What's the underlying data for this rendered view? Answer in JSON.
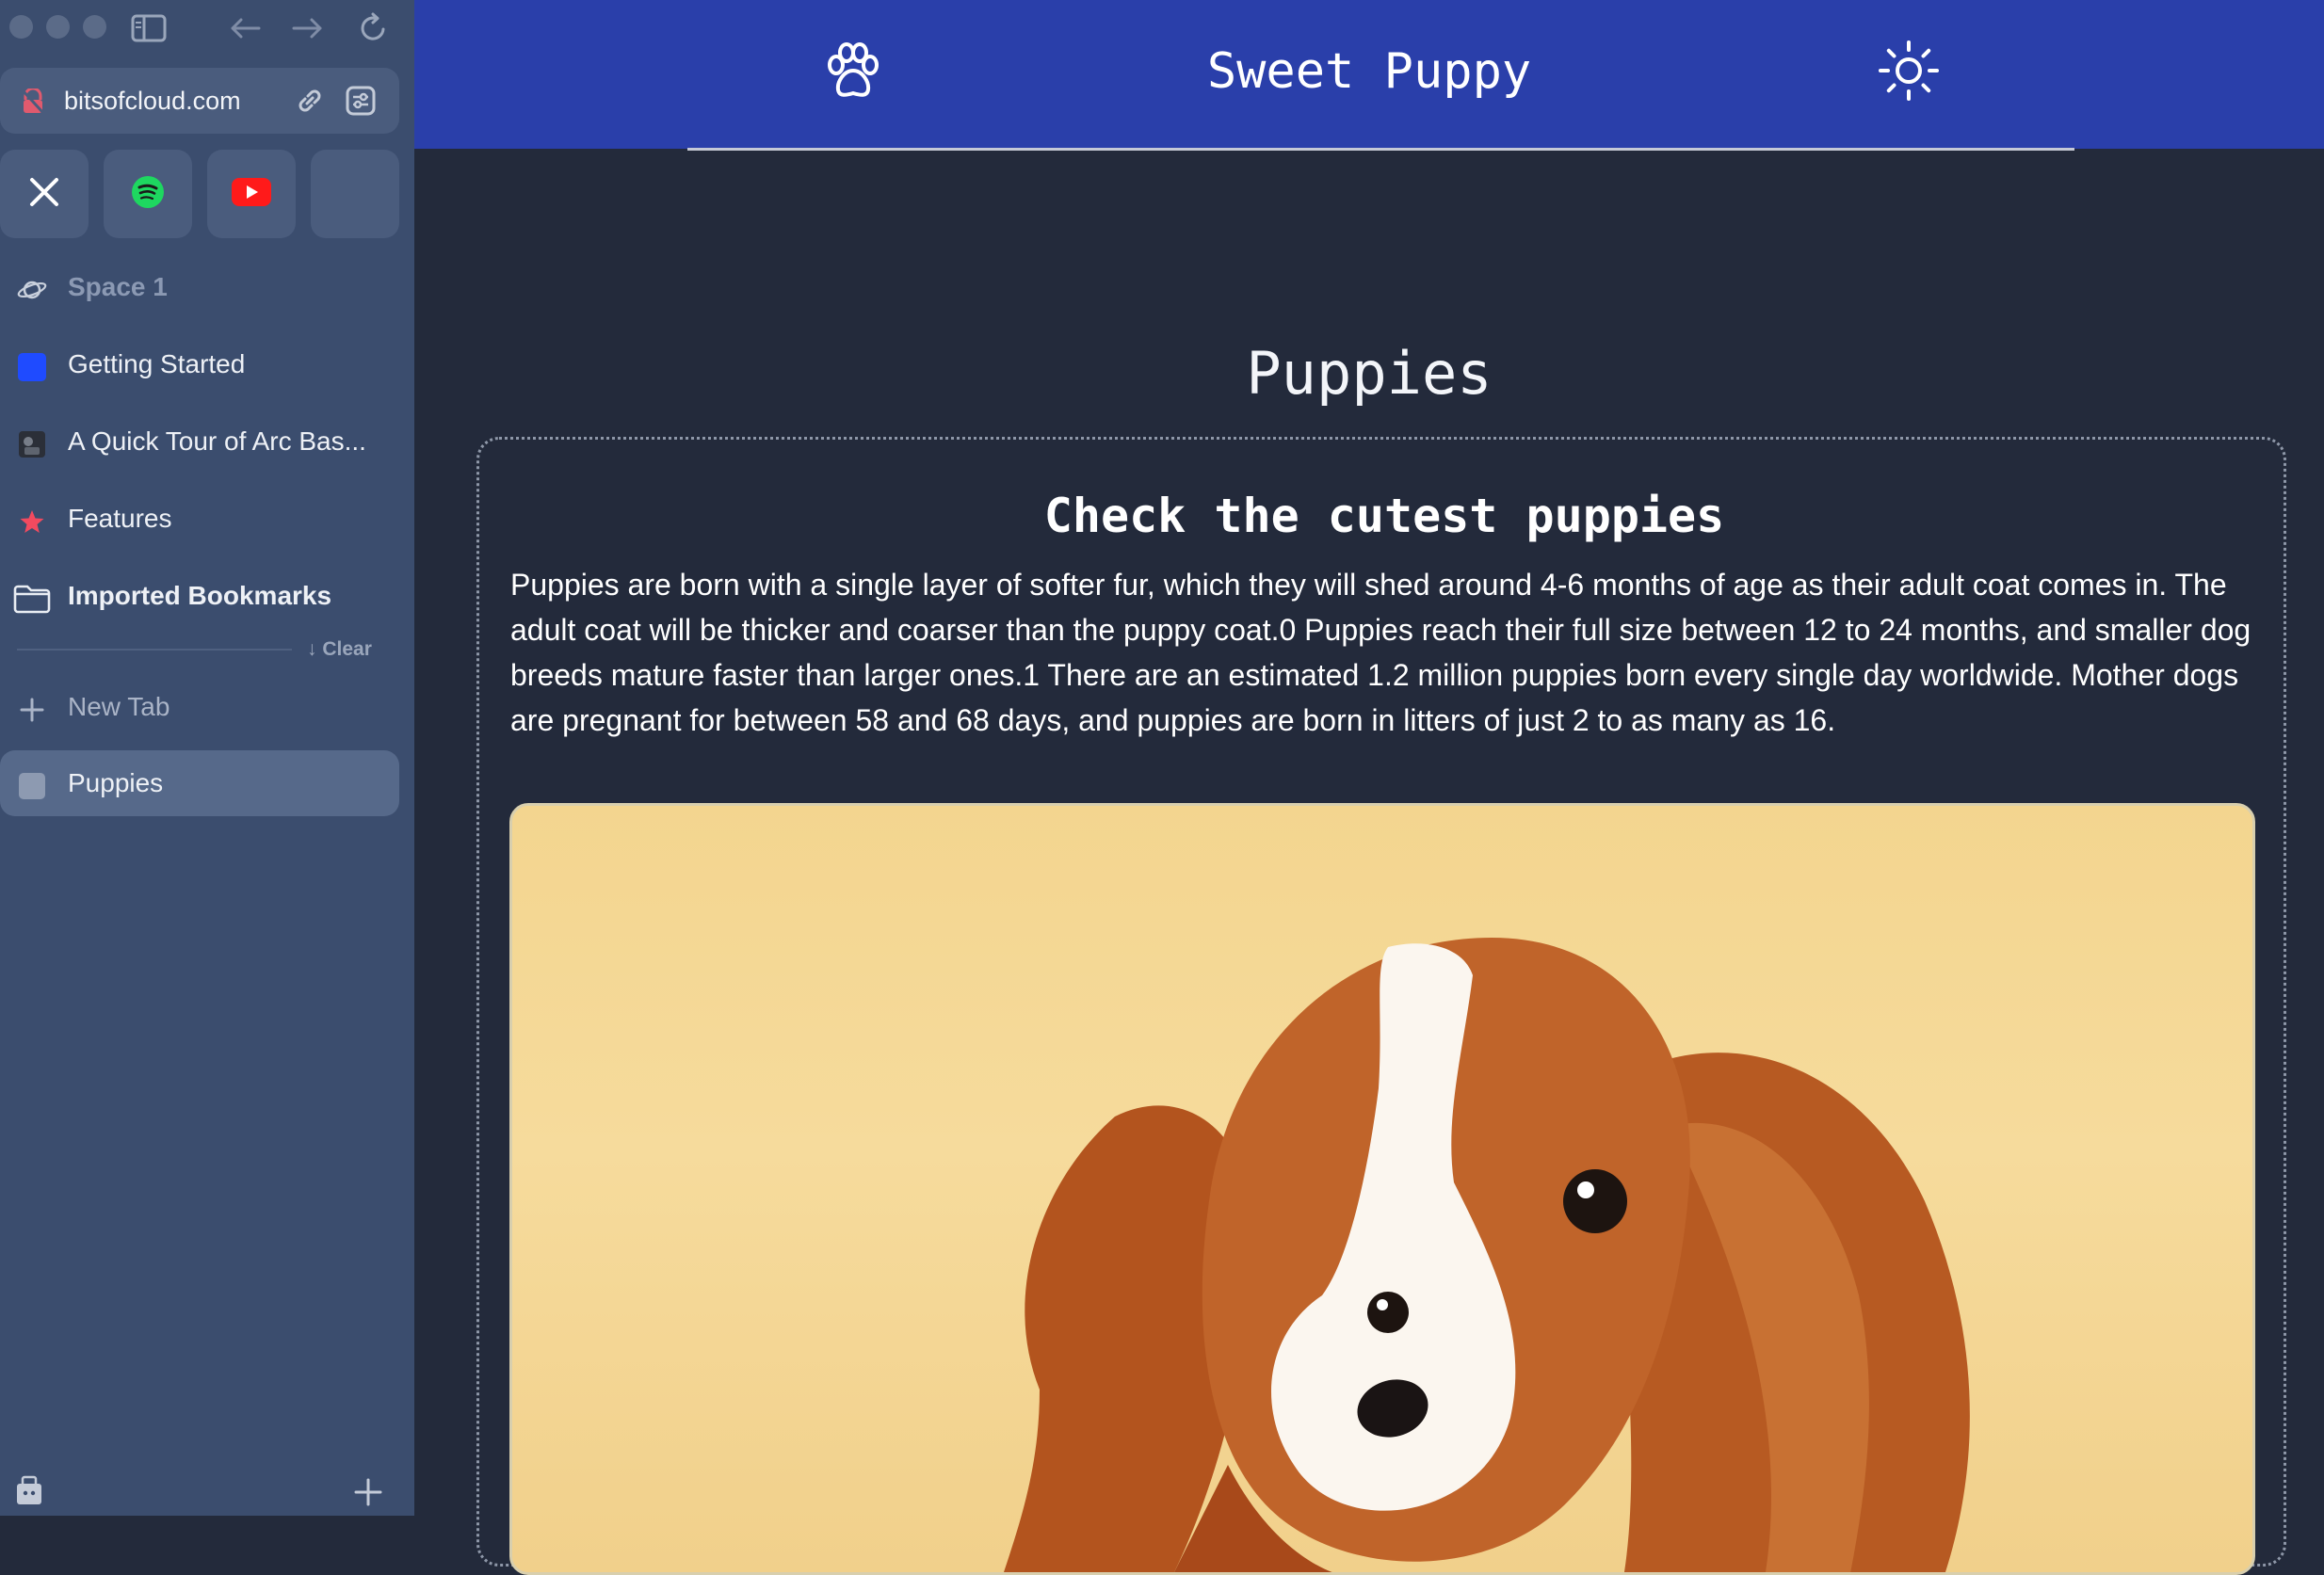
{
  "browser": {
    "url": "bitsofcloud.com",
    "favorites": [
      {
        "icon": "x-logo-icon"
      },
      {
        "icon": "spotify-icon"
      },
      {
        "icon": "youtube-icon"
      },
      {
        "icon": "empty-favorite"
      }
    ],
    "space_label": "Space 1",
    "items": [
      {
        "label": "Getting Started",
        "icon": "blue-square-icon"
      },
      {
        "label": "A Quick Tour of Arc Bas...",
        "icon": "video-thumbnail-icon"
      },
      {
        "label": "Features",
        "icon": "star-icon"
      },
      {
        "label": "Imported Bookmarks",
        "icon": "folder-icon"
      }
    ],
    "clear_label": "↓ Clear",
    "new_tab_label": "New Tab",
    "active_tab_label": "Puppies"
  },
  "site": {
    "brand": "Sweet Puppy",
    "page_title": "Puppies",
    "card_heading": "Check the cutest puppies",
    "card_body": "Puppies are born with a single layer of softer fur, which they will shed around 4-6 months of age as their adult coat comes in. The adult coat will be thicker and coarser than the puppy coat.0 Puppies reach their full size between 12 to 24 months, and smaller dog breeds mature faster than larger ones.1 There are an estimated 1.2 million puppies born every single day worldwide. Mother dogs are pregnant for between 58 and 68 days, and puppies are born in litters of just 2 to as many as 16."
  },
  "colors": {
    "sidebar": "#3b4d6e",
    "header": "#2a3faa",
    "page_bg": "#232a3b",
    "photo_bg": "#f3d58f"
  }
}
